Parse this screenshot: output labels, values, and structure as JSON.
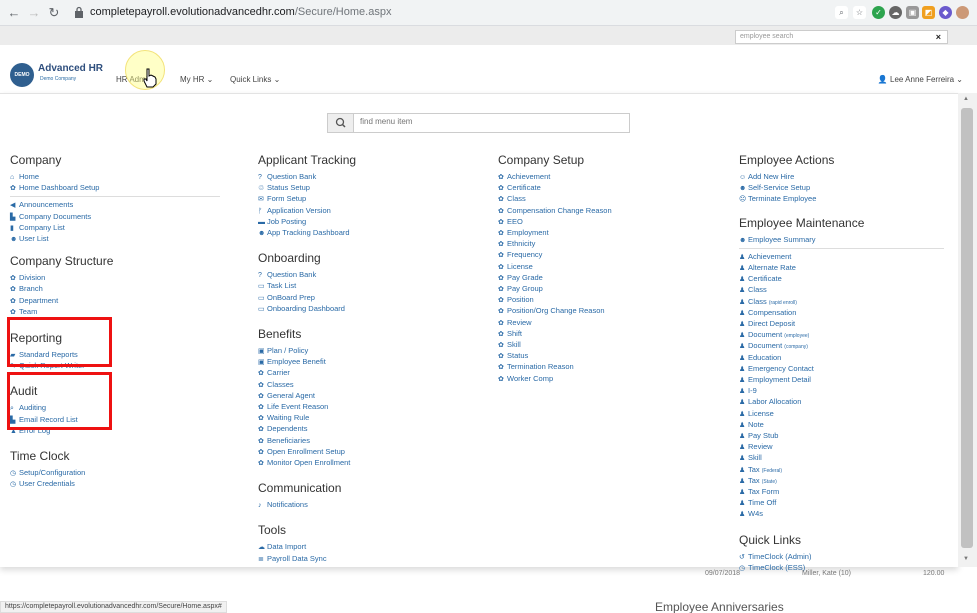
{
  "browser": {
    "url_host": "completepayroll.evolutionadvancedhr.com",
    "url_path": "/Secure/Home.aspx",
    "status_url": "https://completepayroll.evolutionadvancedhr.com/Secure/Home.aspx#"
  },
  "topbar": {
    "employee_search_placeholder": "employee search",
    "clear": "×"
  },
  "brand": {
    "title": "Advanced HR",
    "subtitle": "Demo Company",
    "badge": "DEMO"
  },
  "nav": {
    "hr_admin": "HR Admin",
    "my_hr": "My HR ⌄",
    "quick_links": "Quick Links ⌄",
    "user": "Lee Anne Ferreira ⌄"
  },
  "menu_search": {
    "placeholder": "find menu item"
  },
  "columns": {
    "company": {
      "title": "Company",
      "group1": [
        "Home",
        "Home Dashboard Setup"
      ],
      "group2": [
        "Announcements",
        "Company Documents",
        "Company List",
        "User List"
      ]
    },
    "company_structure": {
      "title": "Company Structure",
      "items": [
        "Division",
        "Branch",
        "Department",
        "Team"
      ]
    },
    "reporting": {
      "title": "Reporting",
      "items": [
        "Standard Reports",
        "Quick Report Writer"
      ]
    },
    "audit": {
      "title": "Audit",
      "items": [
        "Auditing",
        "Email Record List",
        "Error Log"
      ]
    },
    "time_clock": {
      "title": "Time Clock",
      "items": [
        "Setup/Configuration",
        "User Credentials"
      ]
    },
    "applicant_tracking": {
      "title": "Applicant Tracking",
      "items": [
        "Question Bank",
        "Status Setup",
        "Form Setup",
        "Application Version",
        "Job Posting",
        "App Tracking Dashboard"
      ]
    },
    "onboarding": {
      "title": "Onboarding",
      "items": [
        "Question Bank",
        "Task List",
        "OnBoard Prep",
        "Onboarding Dashboard"
      ]
    },
    "benefits": {
      "title": "Benefits",
      "items": [
        "Plan / Policy",
        "Employee Benefit",
        "Carrier",
        "Classes",
        "General Agent",
        "Life Event Reason",
        "Waiting Rule",
        "Dependents",
        "Beneficiaries",
        "Open Enrollment Setup",
        "Monitor Open Enrollment"
      ]
    },
    "communication": {
      "title": "Communication",
      "items": [
        "Notifications"
      ]
    },
    "tools": {
      "title": "Tools",
      "items": [
        "Data Import",
        "Payroll Data Sync"
      ]
    },
    "company_setup": {
      "title": "Company Setup",
      "items": [
        "Achievement",
        "Certificate",
        "Class",
        "Compensation Change Reason",
        "EEO",
        "Employment",
        "Ethnicity",
        "Frequency",
        "License",
        "Pay Grade",
        "Pay Group",
        "Position",
        "Position/Org Change Reason",
        "Review",
        "Shift",
        "Skill",
        "Status",
        "Termination Reason",
        "Worker Comp"
      ]
    },
    "employee_actions": {
      "title": "Employee Actions",
      "items": [
        "Add New Hire",
        "Self-Service Setup",
        "Terminate Employee"
      ]
    },
    "employee_maintenance": {
      "title": "Employee Maintenance",
      "summary": "Employee Summary",
      "items": [
        {
          "label": "Achievement",
          "note": ""
        },
        {
          "label": "Alternate Rate",
          "note": ""
        },
        {
          "label": "Certificate",
          "note": ""
        },
        {
          "label": "Class",
          "note": ""
        },
        {
          "label": "Class",
          "note": "(rapid enroll)"
        },
        {
          "label": "Compensation",
          "note": ""
        },
        {
          "label": "Direct Deposit",
          "note": ""
        },
        {
          "label": "Document",
          "note": "(employee)"
        },
        {
          "label": "Document",
          "note": "(company)"
        },
        {
          "label": "Education",
          "note": ""
        },
        {
          "label": "Emergency Contact",
          "note": ""
        },
        {
          "label": "Employment Detail",
          "note": ""
        },
        {
          "label": "I-9",
          "note": ""
        },
        {
          "label": "Labor Allocation",
          "note": ""
        },
        {
          "label": "License",
          "note": ""
        },
        {
          "label": "Note",
          "note": ""
        },
        {
          "label": "Pay Stub",
          "note": ""
        },
        {
          "label": "Review",
          "note": ""
        },
        {
          "label": "Skill",
          "note": ""
        },
        {
          "label": "Tax",
          "note": "(Federal)"
        },
        {
          "label": "Tax",
          "note": "(State)"
        },
        {
          "label": "Tax Form",
          "note": ""
        },
        {
          "label": "Time Off",
          "note": ""
        },
        {
          "label": "W4s",
          "note": ""
        }
      ]
    },
    "quick_links": {
      "title": "Quick Links",
      "items": [
        "TimeClock (Admin)",
        "TimeClock (ESS)"
      ]
    }
  },
  "background": {
    "row_date": "09/07/2018",
    "row_name": "Miller, Kate (10)",
    "row_value": "120.00",
    "section_title": "Employee Anniversaries"
  },
  "colors": {
    "link": "#2a6aa6",
    "highlight_box": "#e11111"
  }
}
